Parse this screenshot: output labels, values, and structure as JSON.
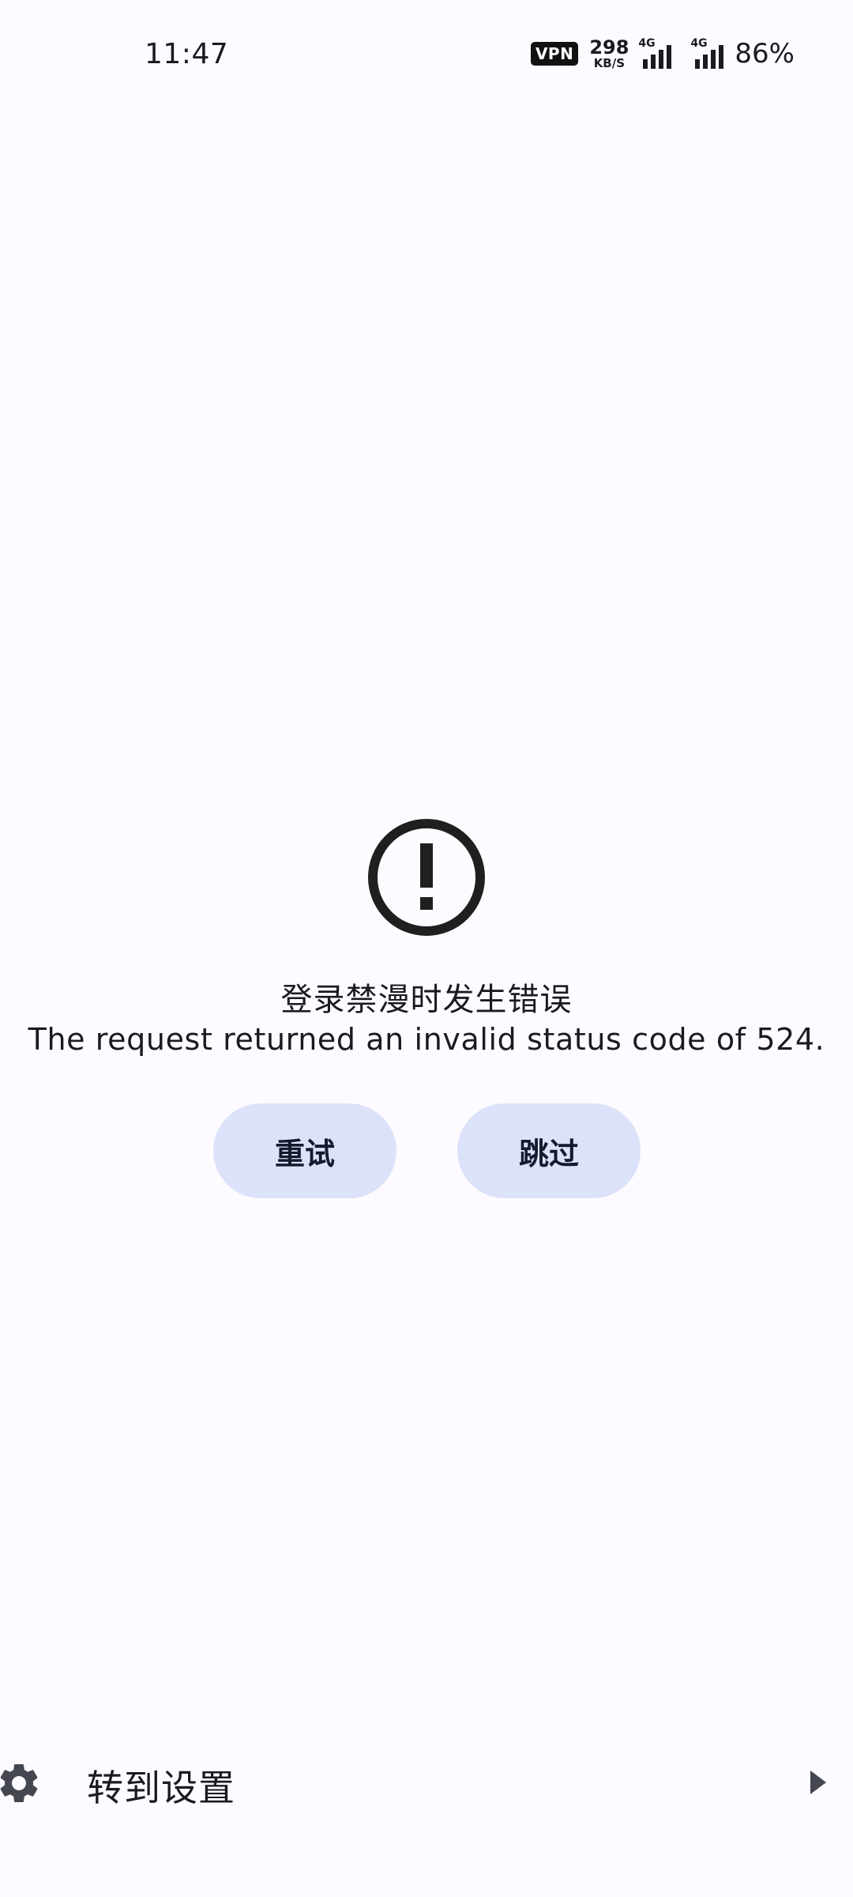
{
  "status_bar": {
    "time": "11:47",
    "vpn": "VPN",
    "net_speed_value": "298",
    "net_speed_unit": "KB/S",
    "network_1": "4G",
    "network_2": "4G",
    "battery": "86%"
  },
  "error": {
    "icon": "error-outline-icon",
    "title": "登录禁漫时发生错误",
    "message": "The request returned an invalid status code of 524."
  },
  "actions": {
    "retry_label": "重试",
    "skip_label": "跳过"
  },
  "settings_row": {
    "icon": "gear-icon",
    "label": "转到设置",
    "arrow": "arrow-right-icon"
  },
  "colors": {
    "background": "#fdfbff",
    "button_background": "#dce2f9",
    "text": "#1b1b1f"
  }
}
